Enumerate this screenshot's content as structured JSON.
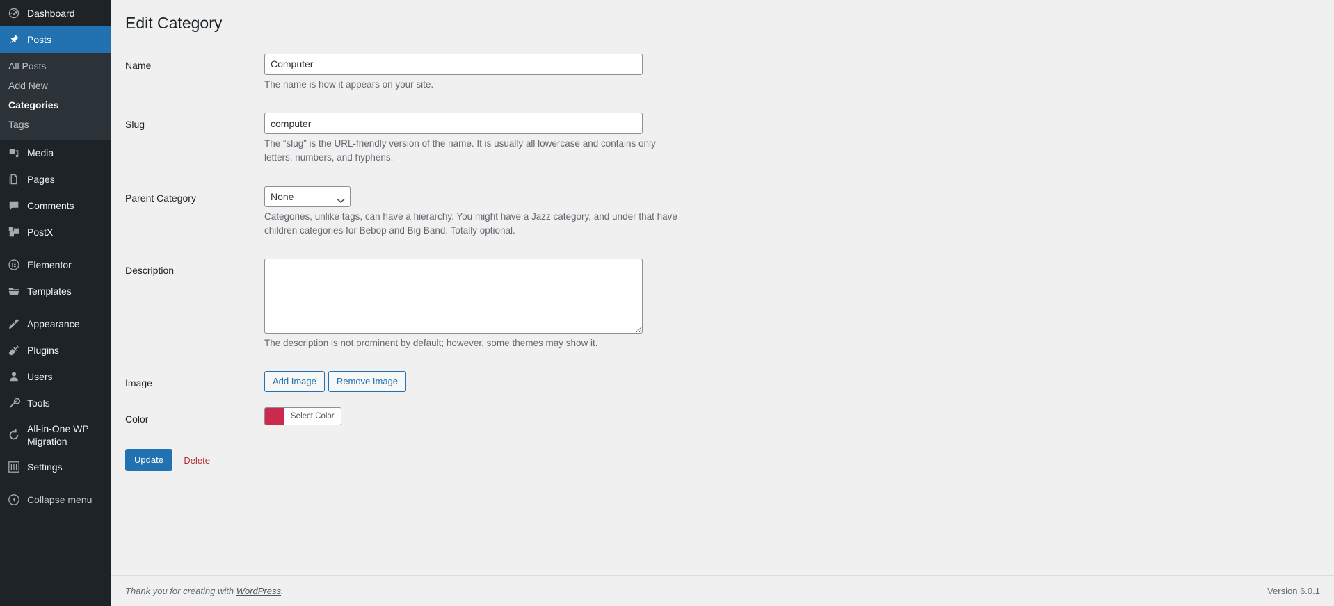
{
  "sidebar": {
    "items": [
      {
        "label": "Dashboard",
        "icon": "dashboard-icon",
        "name": "dashboard"
      },
      {
        "label": "Posts",
        "icon": "pin-icon",
        "name": "posts",
        "active": true
      },
      {
        "label": "Media",
        "icon": "media-icon",
        "name": "media"
      },
      {
        "label": "Pages",
        "icon": "pages-icon",
        "name": "pages"
      },
      {
        "label": "Comments",
        "icon": "comments-icon",
        "name": "comments"
      },
      {
        "label": "PostX",
        "icon": "postx-icon",
        "name": "postx"
      },
      {
        "label": "Elementor",
        "icon": "elementor-icon",
        "name": "elementor"
      },
      {
        "label": "Templates",
        "icon": "folder-icon",
        "name": "templates"
      },
      {
        "label": "Appearance",
        "icon": "brush-icon",
        "name": "appearance"
      },
      {
        "label": "Plugins",
        "icon": "plug-icon",
        "name": "plugins"
      },
      {
        "label": "Users",
        "icon": "user-icon",
        "name": "users"
      },
      {
        "label": "Tools",
        "icon": "wrench-icon",
        "name": "tools"
      },
      {
        "label": "All-in-One WP Migration",
        "icon": "migration-icon",
        "name": "all-in-one-wp-migration"
      },
      {
        "label": "Settings",
        "icon": "sliders-icon",
        "name": "settings"
      }
    ],
    "submenu": [
      {
        "label": "All Posts",
        "name": "all-posts",
        "current": false
      },
      {
        "label": "Add New",
        "name": "add-new",
        "current": false
      },
      {
        "label": "Categories",
        "name": "categories",
        "current": true
      },
      {
        "label": "Tags",
        "name": "tags",
        "current": false
      }
    ],
    "collapse_label": "Collapse menu",
    "active_color": "#2271b1",
    "background_color": "#1d2327",
    "submenu_background_color": "#2c3338"
  },
  "page": {
    "title": "Edit Category"
  },
  "form": {
    "name": {
      "label": "Name",
      "value": "Computer",
      "placeholder": "",
      "description": "The name is how it appears on your site."
    },
    "slug": {
      "label": "Slug",
      "value": "computer",
      "placeholder": "",
      "description": "The “slug” is the URL-friendly version of the name. It is usually all lowercase and contains only letters, numbers, and hyphens."
    },
    "parent": {
      "label": "Parent Category",
      "selected": "None",
      "options": [
        "None"
      ],
      "description": "Categories, unlike tags, can have a hierarchy. You might have a Jazz category, and under that have children categories for Bebop and Big Band. Totally optional."
    },
    "description": {
      "label": "Description",
      "value": "",
      "placeholder": "",
      "description": "The description is not prominent by default; however, some themes may show it."
    },
    "image": {
      "label": "Image",
      "add_label": "Add Image",
      "remove_label": "Remove Image"
    },
    "color": {
      "label": "Color",
      "button_label": "Select Color",
      "value": "#cc2a4d"
    },
    "actions": {
      "update_label": "Update",
      "delete_label": "Delete",
      "primary_color": "#2271b1",
      "delete_color": "#b32d2e"
    }
  },
  "footer": {
    "thanks_prefix": "Thank you for creating with ",
    "link_label": "WordPress",
    "thanks_suffix": ".",
    "version": "Version 6.0.1"
  }
}
